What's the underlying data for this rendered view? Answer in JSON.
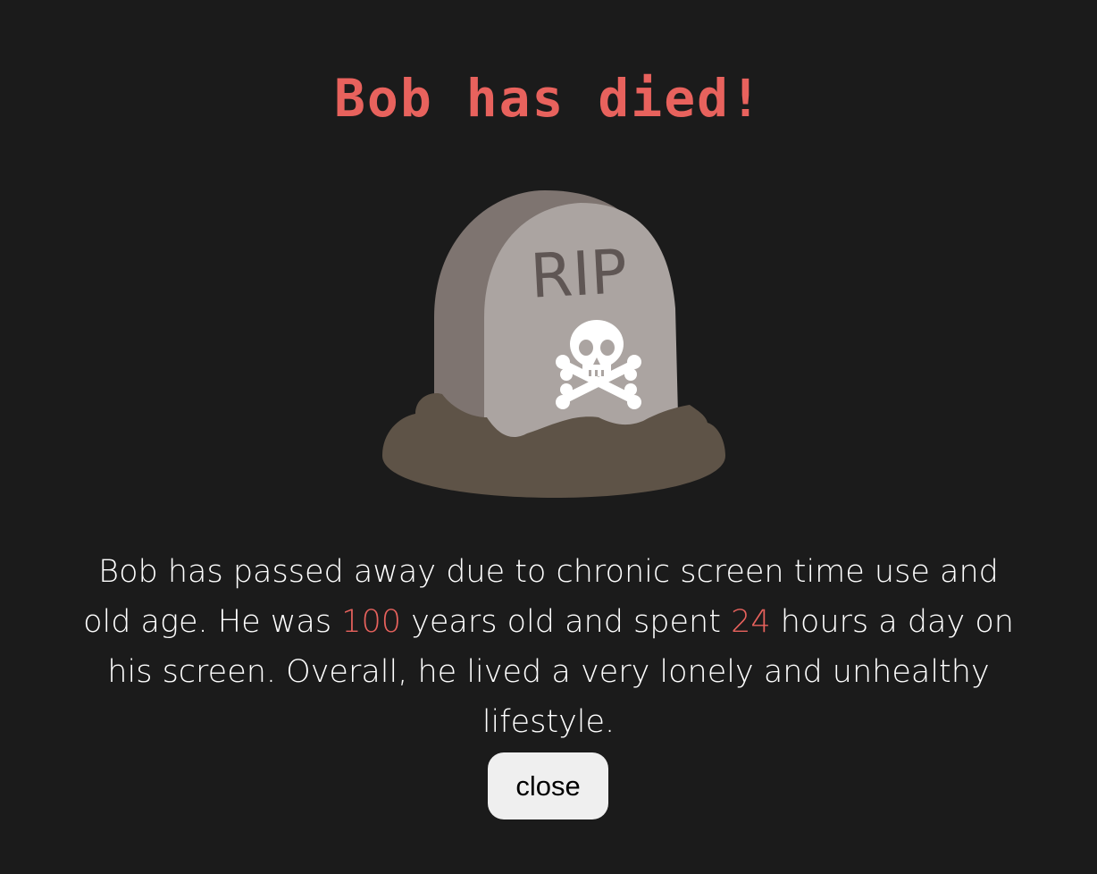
{
  "dialog": {
    "title": "Bob has died!",
    "tombstone": {
      "icon": "tombstone-icon",
      "inscription": "RIP",
      "emblem_icon": "skull-crossbones-icon"
    },
    "message": {
      "part1": "Bob has passed away due to chronic screen time use and old age. He was ",
      "age": "100",
      "part2": " years old and spent ",
      "hours": "24",
      "part3": " hours a day on his screen. Overall, he lived a very lonely and unhealthy lifestyle."
    },
    "close_label": "close"
  },
  "colors": {
    "background": "#1b1b1b",
    "accent": "#e8625d",
    "text": "#ffffff",
    "button_bg": "#efefef"
  }
}
